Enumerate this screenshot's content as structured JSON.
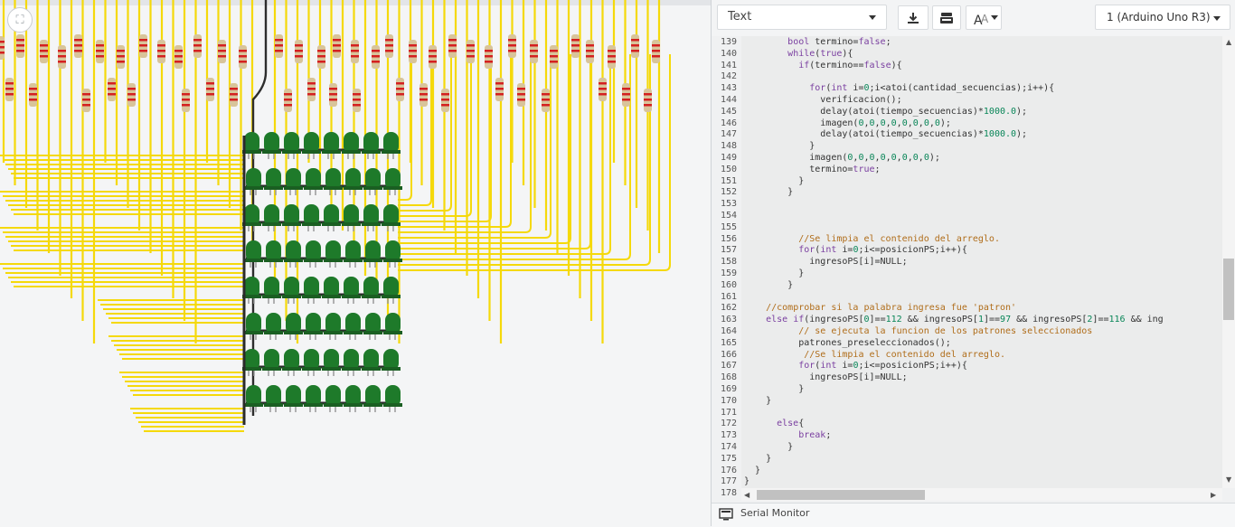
{
  "canvas": {
    "fit_icon": "fit-to-screen-icon"
  },
  "toolbar": {
    "mode_value": "Text",
    "download_icon": "download-icon",
    "upload_icon": "upload-to-board-icon",
    "font_size_icon": "font-size-icon",
    "board_value": "1 (Arduino Uno R3)"
  },
  "editor": {
    "lines": [
      {
        "n": "139",
        "t": "        bool termino=false;"
      },
      {
        "n": "140",
        "t": "        while(true){"
      },
      {
        "n": "141",
        "t": "          if(termino==false){"
      },
      {
        "n": "142",
        "t": ""
      },
      {
        "n": "143",
        "t": "            for(int i=0;i<atoi(cantidad_secuencias);i++){"
      },
      {
        "n": "144",
        "t": "              verificacion();"
      },
      {
        "n": "145",
        "t": "              delay(atoi(tiempo_secuencias)*1000.0);"
      },
      {
        "n": "146",
        "t": "              imagen(0,0,0,0,0,0,0,0);"
      },
      {
        "n": "147",
        "t": "              delay(atoi(tiempo_secuencias)*1000.0);"
      },
      {
        "n": "148",
        "t": "            }"
      },
      {
        "n": "149",
        "t": "            imagen(0,0,0,0,0,0,0,0);"
      },
      {
        "n": "150",
        "t": "            termino=true;"
      },
      {
        "n": "151",
        "t": "          }"
      },
      {
        "n": "152",
        "t": "        }"
      },
      {
        "n": "153",
        "t": ""
      },
      {
        "n": "154",
        "t": ""
      },
      {
        "n": "155",
        "t": ""
      },
      {
        "n": "156",
        "t": "          //Se limpia el contenido del arreglo."
      },
      {
        "n": "157",
        "t": "          for(int i=0;i<=posicionPS;i++){"
      },
      {
        "n": "158",
        "t": "            ingresoPS[i]=NULL;"
      },
      {
        "n": "159",
        "t": "          }"
      },
      {
        "n": "160",
        "t": "        }"
      },
      {
        "n": "161",
        "t": ""
      },
      {
        "n": "162",
        "t": "    //comprobar si la palabra ingresa fue 'patron'"
      },
      {
        "n": "163",
        "t": "    else if(ingresoPS[0]==112 && ingresoPS[1]==97 && ingresoPS[2]==116 && ing"
      },
      {
        "n": "164",
        "t": "          // se ejecuta la funcion de los patrones seleccionados"
      },
      {
        "n": "165",
        "t": "          patrones_preseleccionados();"
      },
      {
        "n": "166",
        "t": "           //Se limpia el contenido del arreglo."
      },
      {
        "n": "167",
        "t": "          for(int i=0;i<=posicionPS;i++){"
      },
      {
        "n": "168",
        "t": "            ingresoPS[i]=NULL;"
      },
      {
        "n": "169",
        "t": "          }"
      },
      {
        "n": "170",
        "t": "    }"
      },
      {
        "n": "171",
        "t": ""
      },
      {
        "n": "172",
        "t": "      else{"
      },
      {
        "n": "173",
        "t": "          break;"
      },
      {
        "n": "174",
        "t": "        }"
      },
      {
        "n": "175",
        "t": "    }"
      },
      {
        "n": "176",
        "t": "  }"
      },
      {
        "n": "177",
        "t": "}"
      },
      {
        "n": "178",
        "t": ""
      }
    ]
  },
  "serial_monitor": {
    "icon": "serial-monitor-icon",
    "label": "Serial Monitor"
  },
  "colors": {
    "wire": "#f5d90a",
    "led": "#1e7a2a",
    "resistor_body": "#d8c49a",
    "stripe": "#d42020",
    "black_wire": "#2d2d2d"
  }
}
